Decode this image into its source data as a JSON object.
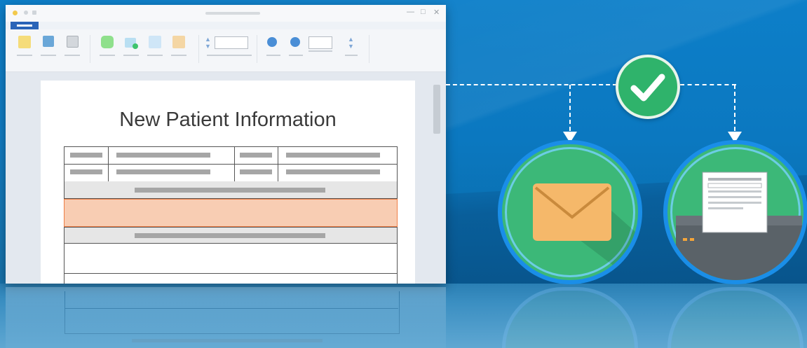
{
  "document": {
    "title": "New Patient Information"
  },
  "colors": {
    "background": "#0b78c0",
    "check_green": "#2fb36b",
    "circle_green": "#3cb878",
    "circle_ring": "#1a8ee8",
    "highlight_row": "#f8cdb3",
    "highlight_border": "#ee7d45",
    "envelope": "#f5b86a"
  },
  "icons": {
    "check": "check-icon",
    "email": "envelope-icon",
    "print": "printer-icon"
  }
}
